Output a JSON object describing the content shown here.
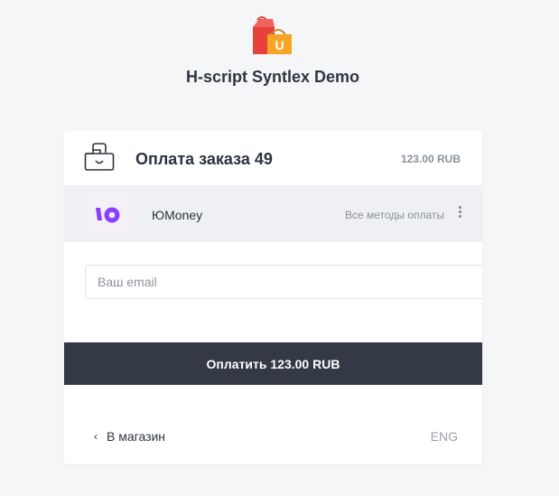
{
  "site": {
    "title": "H-script Syntlex Demo",
    "logo_letter": "U"
  },
  "order": {
    "title": "Оплата заказа 49",
    "amount": "123.00 RUB"
  },
  "payment_method": {
    "name": "ЮMoney",
    "all_methods_label": "Все методы оплаты"
  },
  "email": {
    "placeholder": "Ваш email",
    "value": ""
  },
  "pay_button": {
    "label": "Оплатить 123.00 RUB"
  },
  "footer": {
    "back_icon": "‹",
    "back_label": "В магазин",
    "language": "ENG"
  },
  "colors": {
    "background": "#f5f6f8",
    "pay_button": "#333a45",
    "yoomoney_purple": "#8b3ffd",
    "bag_red": "#e8403a",
    "bag_orange": "#f6a524"
  }
}
